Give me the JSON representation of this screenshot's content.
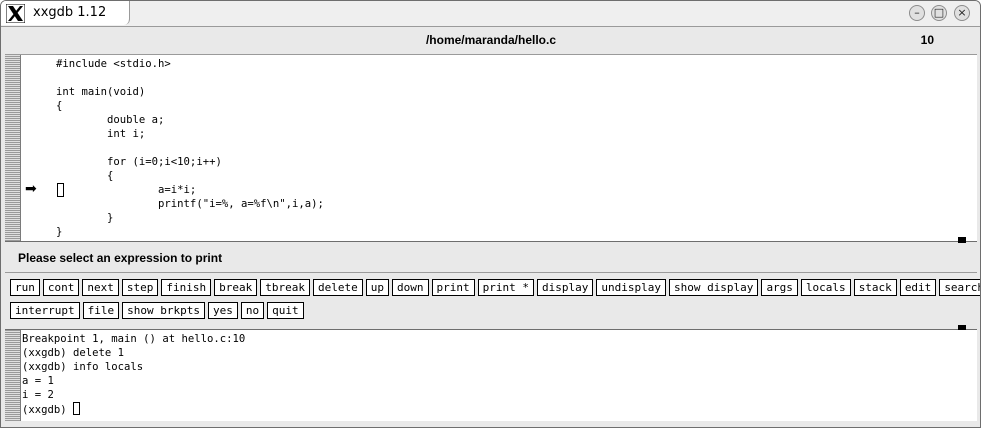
{
  "window": {
    "title": "xxgdb 1.12"
  },
  "file": {
    "path": "/home/maranda/hello.c",
    "line": "10"
  },
  "source": {
    "code": "#include <stdio.h>\n\nint main(void)\n{\n        double a;\n        int i;\n\n        for (i=0;i<10;i++)\n        {\n                a=i*i;\n                printf(\"i=%, a=%f\\n\",i,a);\n        }\n}",
    "arrow_glyph": "➡"
  },
  "message": "Please select an expression to print",
  "commands": {
    "row1": [
      "run",
      "cont",
      "next",
      "step",
      "finish",
      "break",
      "tbreak",
      "delete",
      "up",
      "down",
      "print",
      "print *",
      "display",
      "undisplay",
      "show display",
      "args",
      "locals",
      "stack",
      "edit",
      "search"
    ],
    "row2": [
      "interrupt",
      "file",
      "show brkpts",
      "yes",
      "no",
      "quit"
    ]
  },
  "dialog": {
    "text": "Breakpoint 1, main () at hello.c:10\n(xxgdb) delete 1\n(xxgdb) info locals\na = 1\ni = 2\n(xxgdb) "
  },
  "icons": {
    "window_minimize": "minimize-icon",
    "window_maximize": "maximize-icon",
    "window_close": "close-icon",
    "app_logo": "x-logo-icon"
  }
}
